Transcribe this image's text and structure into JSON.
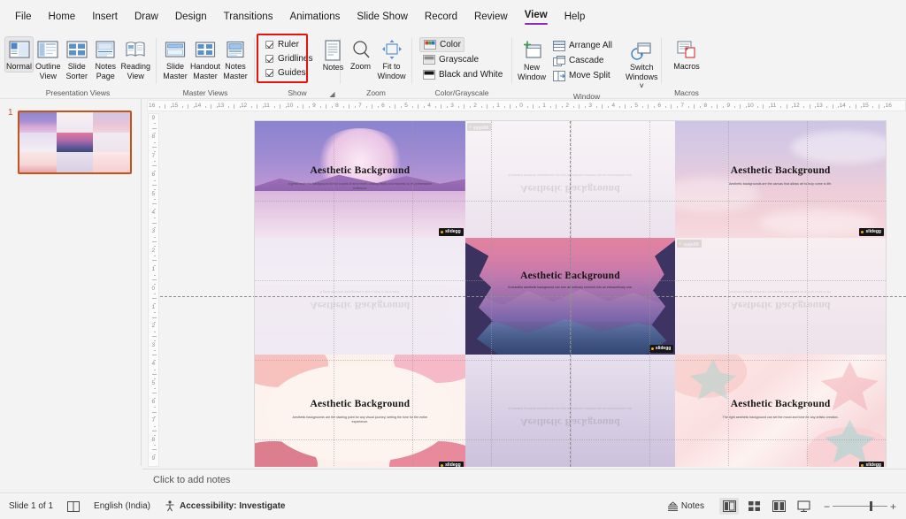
{
  "app": {
    "title": "Microsoft PowerPoint"
  },
  "menubar": {
    "items": [
      {
        "label": "File",
        "active": false
      },
      {
        "label": "Home",
        "active": false
      },
      {
        "label": "Insert",
        "active": false
      },
      {
        "label": "Draw",
        "active": false
      },
      {
        "label": "Design",
        "active": false
      },
      {
        "label": "Transitions",
        "active": false
      },
      {
        "label": "Animations",
        "active": false
      },
      {
        "label": "Slide Show",
        "active": false
      },
      {
        "label": "Record",
        "active": false
      },
      {
        "label": "Review",
        "active": false
      },
      {
        "label": "View",
        "active": true
      },
      {
        "label": "Help",
        "active": false
      }
    ]
  },
  "ribbon": {
    "groups": [
      {
        "caption": "Presentation Views",
        "buttons": [
          {
            "label_line1": "Normal",
            "label_line2": "",
            "icon": "normal-view-icon",
            "selected": true
          },
          {
            "label_line1": "Outline",
            "label_line2": "View",
            "icon": "outline-view-icon",
            "selected": false
          },
          {
            "label_line1": "Slide",
            "label_line2": "Sorter",
            "icon": "slide-sorter-icon",
            "selected": false
          },
          {
            "label_line1": "Notes",
            "label_line2": "Page",
            "icon": "notes-page-icon",
            "selected": false
          },
          {
            "label_line1": "Reading",
            "label_line2": "View",
            "icon": "reading-view-icon",
            "selected": false
          }
        ]
      },
      {
        "caption": "Master Views",
        "buttons": [
          {
            "label_line1": "Slide",
            "label_line2": "Master",
            "icon": "slide-master-icon",
            "selected": false
          },
          {
            "label_line1": "Handout",
            "label_line2": "Master",
            "icon": "handout-master-icon",
            "selected": false
          },
          {
            "label_line1": "Notes",
            "label_line2": "Master",
            "icon": "notes-master-icon",
            "selected": false
          }
        ]
      },
      {
        "caption": "Show",
        "checkboxes": [
          {
            "label": "Ruler",
            "checked": true
          },
          {
            "label": "Gridlines",
            "checked": true
          },
          {
            "label": "Guides",
            "checked": true
          }
        ],
        "buttons": [
          {
            "label_line1": "Notes",
            "label_line2": "",
            "icon": "notes-icon",
            "selected": false
          }
        ],
        "dialog_launcher": true,
        "highlighted": true,
        "highlight_color": "#e8120f"
      },
      {
        "caption": "Zoom",
        "buttons": [
          {
            "label_line1": "Zoom",
            "label_line2": "",
            "icon": "zoom-magnifier-icon",
            "selected": false
          },
          {
            "label_line1": "Fit to",
            "label_line2": "Window",
            "icon": "fit-to-window-icon",
            "selected": false
          }
        ]
      },
      {
        "caption": "Color/Grayscale",
        "stacked": [
          {
            "label": "Color",
            "icon": "color-swatch-icon",
            "selected": true
          },
          {
            "label": "Grayscale",
            "icon": "grayscale-icon",
            "selected": false
          },
          {
            "label": "Black and White",
            "icon": "black-and-white-icon",
            "selected": false
          }
        ]
      },
      {
        "caption": "Window",
        "buttons": [
          {
            "label_line1": "New",
            "label_line2": "Window",
            "icon": "new-window-icon",
            "selected": false
          }
        ],
        "stacked": [
          {
            "label": "Arrange All",
            "icon": "arrange-all-icon",
            "selected": false
          },
          {
            "label": "Cascade",
            "icon": "cascade-icon",
            "selected": false
          },
          {
            "label": "Move Split",
            "icon": "move-split-icon",
            "selected": false
          }
        ],
        "buttons2": [
          {
            "label_line1": "Switch",
            "label_line2": "Windows ˅",
            "icon": "switch-windows-icon",
            "selected": false
          }
        ]
      },
      {
        "caption": "Macros",
        "buttons": [
          {
            "label_line1": "Macros",
            "label_line2": "",
            "icon": "macros-icon",
            "selected": false
          }
        ]
      }
    ]
  },
  "thumbnail_pane": {
    "slide_number": "1",
    "selected": true
  },
  "rulers": {
    "horizontal_ticks": [
      "16",
      "15",
      "14",
      "13",
      "12",
      "11",
      "10",
      "9",
      "8",
      "7",
      "6",
      "5",
      "4",
      "3",
      "2",
      "1",
      "0",
      "1",
      "2",
      "3",
      "4",
      "5",
      "6",
      "7",
      "8",
      "9",
      "10",
      "11",
      "12",
      "13",
      "14",
      "15",
      "16"
    ],
    "vertical_ticks": [
      "9",
      "8",
      "7",
      "6",
      "5",
      "4",
      "3",
      "2",
      "1",
      "0",
      "1",
      "2",
      "3",
      "4",
      "5",
      "6",
      "7",
      "8",
      "9"
    ]
  },
  "slide": {
    "cells": [
      {
        "position": "top-left",
        "title": "Aesthetic Background",
        "subtitle": "A great aesthetic background is like a work of art in itself, analog depth and richness to its presentation endeavor.",
        "badge": "slidegg",
        "theme": "purple-night-mountains",
        "flipped": false,
        "faded": false
      },
      {
        "position": "top-center",
        "title": "Aesthetic Background",
        "subtitle": "A beautiful aesthetic background can turn an ordinary moment into an extraordinary one.",
        "badge": "slidegg",
        "theme": "pale-lavender-reflection",
        "flipped": true,
        "faded": true
      },
      {
        "position": "top-right",
        "title": "Aesthetic Background",
        "subtitle": "Aesthetic backgrounds are the canvas that allows art to truly come to life.",
        "badge": "slidegg",
        "theme": "pink-lavender-clouds",
        "flipped": false,
        "faded": false
      },
      {
        "position": "middle-left",
        "title": "Aesthetic Background",
        "subtitle": "A great aesthetic background is like a work of art in itself.",
        "badge": "slidegg",
        "theme": "purple-night-mountains",
        "flipped": true,
        "faded": true
      },
      {
        "position": "middle-center",
        "title": "Aesthetic Background",
        "subtitle": "A beautiful aesthetic background can turn an ordinary moment into an extraordinary one.",
        "badge": "slidegg",
        "theme": "sunset-forest-valley",
        "flipped": false,
        "faded": false
      },
      {
        "position": "middle-right",
        "title": "Aesthetic Background",
        "subtitle": "Aesthetic backgrounds are the canvas that allows art to truly come to life.",
        "badge": "slidegg",
        "theme": "pink-lavender-clouds",
        "flipped": true,
        "faded": true
      },
      {
        "position": "bottom-left",
        "title": "Aesthetic Background",
        "subtitle": "Aesthetic backgrounds are the starting point for any visual journey, setting the tone for the entire experience.",
        "badge": "slidegg",
        "theme": "pink-blob-abstract",
        "flipped": false,
        "faded": false
      },
      {
        "position": "bottom-center",
        "title": "Aesthetic Background",
        "subtitle": "A beautiful aesthetic background can turn an ordinary moment into an extraordinary one.",
        "badge": "slidegg",
        "theme": "sunset-forest-valley",
        "flipped": true,
        "faded": true
      },
      {
        "position": "bottom-right",
        "title": "Aesthetic Background",
        "subtitle": "The right aesthetic background can set the mood and tone for any artistic creation.",
        "badge": "slidegg",
        "theme": "pink-tropical-leaves",
        "flipped": false,
        "faded": false
      }
    ]
  },
  "notes": {
    "placeholder": "Click to add notes"
  },
  "statusbar": {
    "slide_count": "Slide 1 of 1",
    "language": "English (India)",
    "accessibility": "Accessibility: Investigate",
    "notes_label": "Notes",
    "views": [
      {
        "name": "normal-view",
        "selected": true
      },
      {
        "name": "slide-sorter-view",
        "selected": false
      },
      {
        "name": "reading-view",
        "selected": false
      },
      {
        "name": "slideshow-view",
        "selected": false
      }
    ],
    "zoom_minus": "−",
    "zoom_plus": "+"
  },
  "colors": {
    "accent": "#8b2bb8",
    "highlight": "#e8120f",
    "thumb_border": "#c4551a",
    "ribbon_bg": "#f3f3f3"
  }
}
